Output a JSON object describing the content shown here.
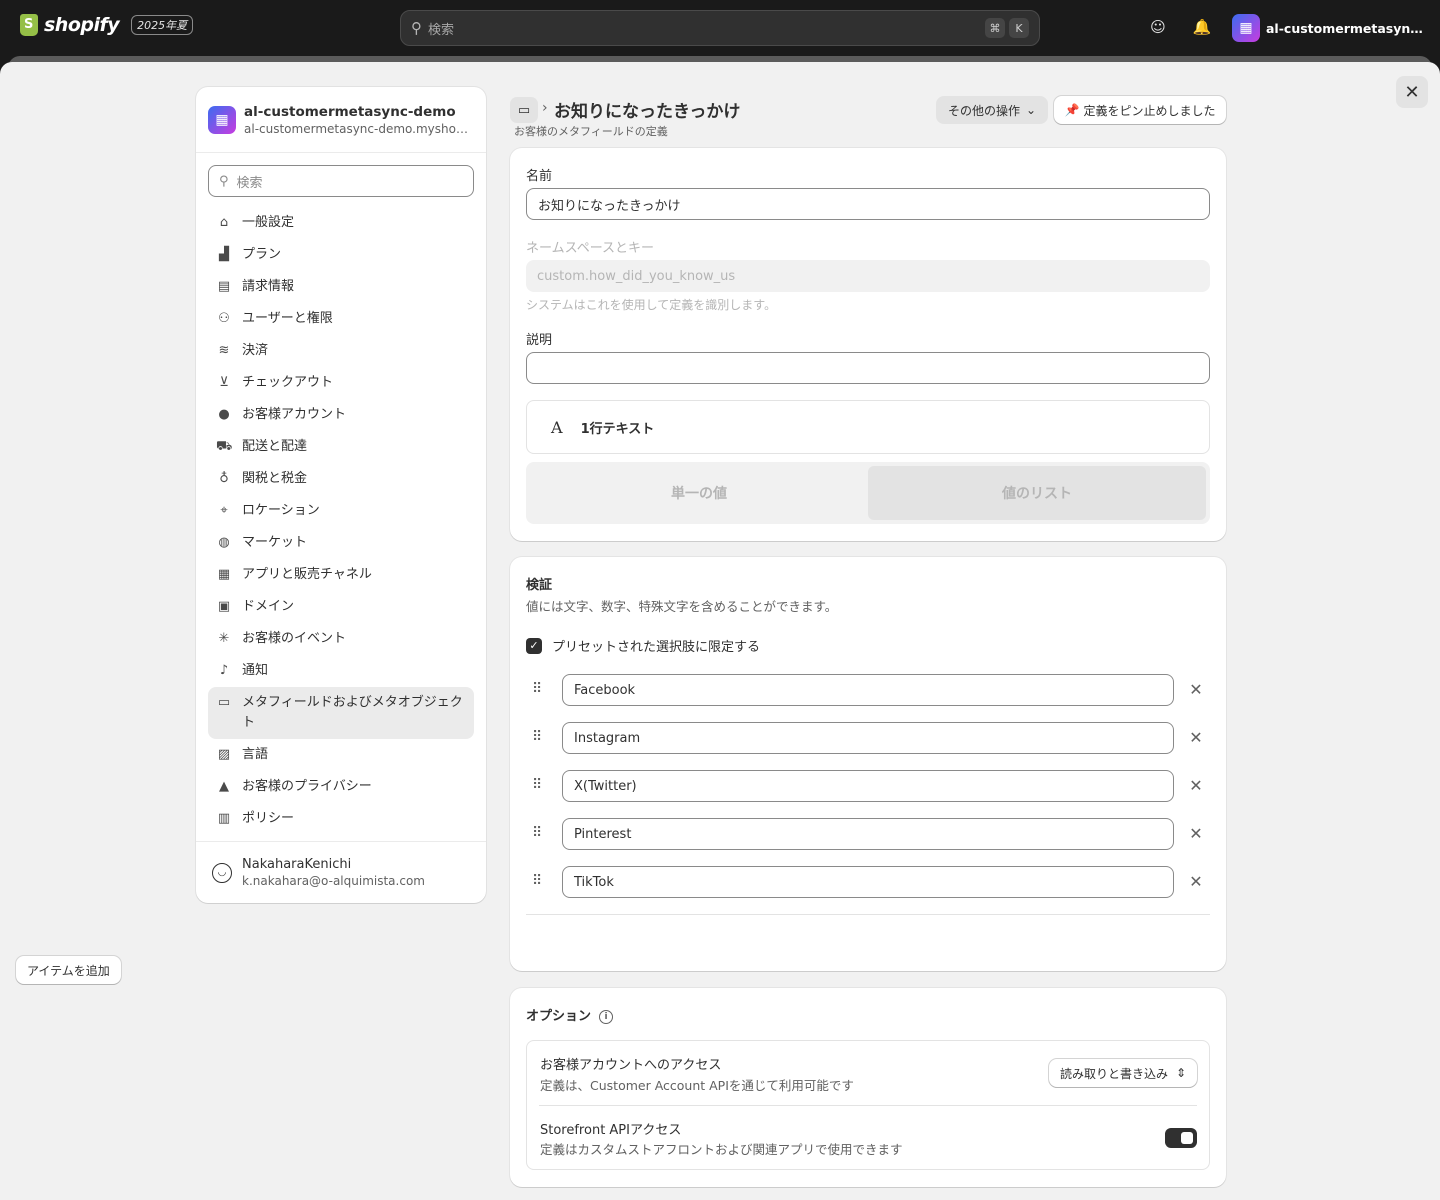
{
  "topbar": {
    "brand": "shopify",
    "edition": "2025年夏",
    "search_placeholder": "検索",
    "shortcut_keys": [
      "⌘",
      "K"
    ],
    "store_name": "al-customermetasync-de…"
  },
  "sidebar": {
    "store_name": "al-customermetasync-demo",
    "store_url": "al-customermetasync-demo.myshopify.com",
    "search_placeholder": "検索",
    "items": [
      {
        "label": "一般設定",
        "icon": "store-icon",
        "active": false
      },
      {
        "label": "プラン",
        "icon": "plan-icon",
        "active": false
      },
      {
        "label": "請求情報",
        "icon": "receipt-icon",
        "active": false
      },
      {
        "label": "ユーザーと権限",
        "icon": "users-icon",
        "active": false
      },
      {
        "label": "決済",
        "icon": "payment-icon",
        "active": false
      },
      {
        "label": "チェックアウト",
        "icon": "cart-icon",
        "active": false
      },
      {
        "label": "お客様アカウント",
        "icon": "person-icon",
        "active": false
      },
      {
        "label": "配送と配達",
        "icon": "truck-icon",
        "active": false
      },
      {
        "label": "関税と税金",
        "icon": "tax-icon",
        "active": false
      },
      {
        "label": "ロケーション",
        "icon": "location-icon",
        "active": false
      },
      {
        "label": "マーケット",
        "icon": "globe-icon",
        "active": false
      },
      {
        "label": "アプリと販売チャネル",
        "icon": "apps-icon",
        "active": false
      },
      {
        "label": "ドメイン",
        "icon": "domain-icon",
        "active": false
      },
      {
        "label": "お客様のイベント",
        "icon": "cursor-icon",
        "active": false
      },
      {
        "label": "通知",
        "icon": "bell-icon",
        "active": false
      },
      {
        "label": "メタフィールドおよびメタオブジェクト",
        "icon": "metafield-icon",
        "active": true
      },
      {
        "label": "言語",
        "icon": "language-icon",
        "active": false
      },
      {
        "label": "お客様のプライバシー",
        "icon": "lock-icon",
        "active": false
      },
      {
        "label": "ポリシー",
        "icon": "policy-icon",
        "active": false
      }
    ],
    "user_name": "NakaharaKenichi",
    "user_email": "k.nakahara@o-alquimista.com"
  },
  "page": {
    "title": "お知りになったきっかけ",
    "subtitle": "お客様のメタフィールドの定義",
    "more_actions": "その他の操作",
    "pinned": "定義をピン止めしました"
  },
  "definition": {
    "name_label": "名前",
    "name_value": "お知りになったきっかけ",
    "namespace_label": "ネームスペースとキー",
    "namespace_value": "custom.how_did_you_know_us",
    "namespace_help": "システムはこれを使用して定義を識別します。",
    "description_label": "説明",
    "description_value": "",
    "type_icon": "A",
    "type_name": "1行テキスト",
    "single_value": "単一の値",
    "list_value": "値のリスト"
  },
  "validation": {
    "title": "検証",
    "description": "値には文字、数字、特殊文字を含めることができます。",
    "preset_label": "プリセットされた選択肢に限定する",
    "preset_checked": true,
    "choices": [
      "Facebook",
      "Instagram",
      "X(Twitter)",
      "Pinterest",
      "TikTok"
    ],
    "add_item": "アイテムを追加"
  },
  "options": {
    "title": "オプション",
    "customer_access_title": "お客様アカウントへのアクセス",
    "customer_access_desc": "定義は、Customer Account APIを通じて利用可能です",
    "customer_access_value": "読み取りと書き込み",
    "storefront_title": "Storefront APIアクセス",
    "storefront_desc": "定義はカスタムストアフロントおよび関連アプリで使用できます",
    "storefront_enabled": true
  }
}
